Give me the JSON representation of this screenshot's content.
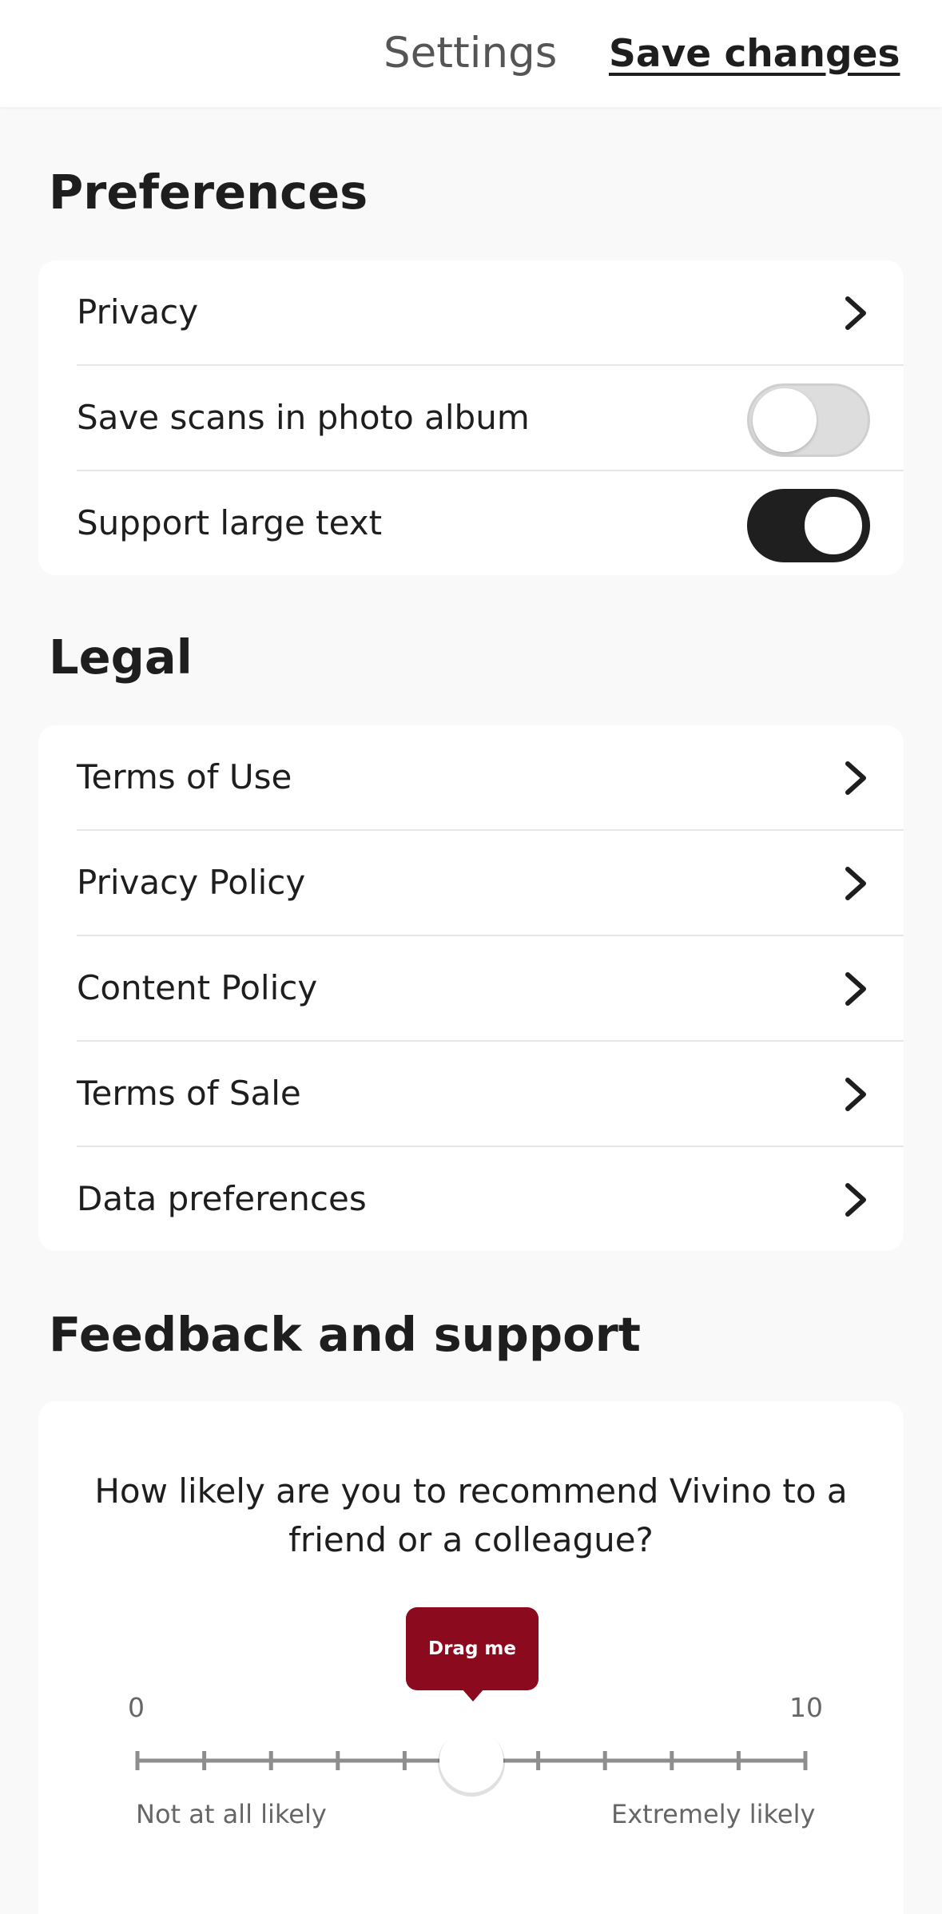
{
  "header": {
    "title": "Settings",
    "save_label": "Save changes"
  },
  "preferences": {
    "title": "Preferences",
    "items": [
      {
        "label": "Privacy",
        "type": "link",
        "icon": "chevron-right-icon"
      },
      {
        "label": "Save scans in photo album",
        "type": "toggle",
        "on": false
      },
      {
        "label": "Support large text",
        "type": "toggle",
        "on": true
      }
    ]
  },
  "legal": {
    "title": "Legal",
    "items": [
      {
        "label": "Terms of Use",
        "icon": "chevron-right-icon"
      },
      {
        "label": "Privacy Policy",
        "icon": "chevron-right-icon"
      },
      {
        "label": "Content Policy",
        "icon": "chevron-right-icon"
      },
      {
        "label": "Terms of Sale",
        "icon": "chevron-right-icon"
      },
      {
        "label": "Data preferences",
        "icon": "chevron-right-icon"
      }
    ]
  },
  "feedback": {
    "title": "Feedback and support",
    "question": "How likely are you to recommend Vivino to a friend or a colleague?",
    "tooltip": "Drag me",
    "scale_min": "0",
    "scale_max": "10",
    "min_value": 0,
    "max_value": 10,
    "current_value": 5,
    "label_left": "Not at all likely",
    "label_right": "Extremely likely"
  },
  "colors": {
    "accent": "#8b0a1d",
    "toggle_on": "#1f1f1f",
    "toggle_off": "#dddddd"
  }
}
